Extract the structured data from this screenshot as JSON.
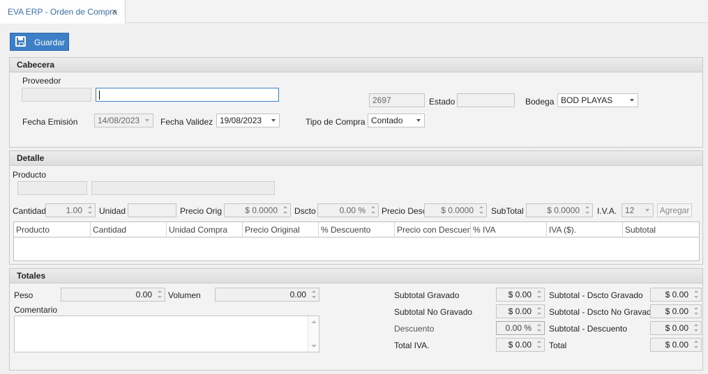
{
  "tab": {
    "title": "EVA ERP - Orden de Compra",
    "close": "×"
  },
  "toolbar": {
    "save_label": "Guardar"
  },
  "cabecera": {
    "title": "Cabecera",
    "proveedor_label": "Proveedor",
    "proveedor_code": "",
    "proveedor_name": "",
    "numero": "2697",
    "estado_label": "Estado",
    "estado_value": "",
    "bodega_label": "Bodega",
    "bodega_value": "BOD PLAYAS",
    "fecha_emision_label": "Fecha Emisión",
    "fecha_emision_value": "14/08/2023",
    "fecha_validez_label": "Fecha Validez",
    "fecha_validez_value": "19/08/2023",
    "tipo_compra_label": "Tipo de Compra",
    "tipo_compra_value": "Contado"
  },
  "detalle": {
    "title": "Detalle",
    "producto_label": "Producto",
    "producto_code": "",
    "producto_name": "",
    "cantidad_label": "Cantidad",
    "cantidad_value": "1.00",
    "unidad_label": "Unidad",
    "unidad_value": "",
    "precio_orig_label": "Precio Orig",
    "precio_orig_value": "$ 0.0000",
    "dscto_label": "Dscto",
    "dscto_value": "0.00 %",
    "precio_desc_label": "Precio Desc",
    "precio_desc_value": "$ 0.0000",
    "subtotal_label": "SubTotal",
    "subtotal_value": "$ 0.0000",
    "iva_label": "I.V.A.",
    "iva_value": "12",
    "agregar_label": "Agregar",
    "columns": [
      "Producto",
      "Cantidad",
      "Unidad Compra",
      "Precio Original",
      "% Descuento",
      "Precio con Descuento",
      "% IVA",
      "IVA ($).",
      "Subtotal"
    ]
  },
  "totales": {
    "title": "Totales",
    "peso_label": "Peso",
    "peso_value": "0.00",
    "volumen_label": "Volumen",
    "volumen_value": "0.00",
    "comentario_label": "Comentario",
    "comentario_value": "",
    "subtotal_gravado_label": "Subtotal Gravado",
    "subtotal_gravado_value": "$ 0.00",
    "subtotal_no_gravado_label": "Subtotal No Gravado",
    "subtotal_no_gravado_value": "$ 0.00",
    "descuento_label": "Descuento",
    "descuento_value": "0.00 %",
    "total_iva_label": "Total IVA.",
    "total_iva_value": "$ 0.00",
    "dscto_gravado_label": "Subtotal  - Dscto Gravado",
    "dscto_gravado_value": "$ 0.00",
    "dscto_no_gravado_label": "Subtotal  - Dscto No Gravado",
    "dscto_no_gravado_value": "$ 0.00",
    "sub_descuento_label": "Subtotal  - Descuento",
    "sub_descuento_value": "$ 0.00",
    "total_label": "Total",
    "total_value": "$ 0.00"
  }
}
